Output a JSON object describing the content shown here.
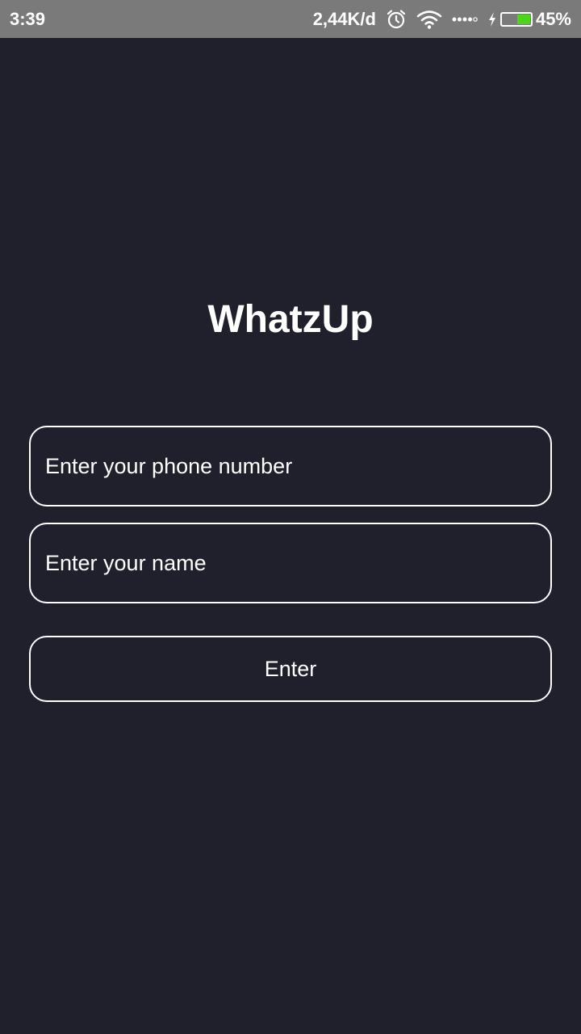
{
  "status_bar": {
    "time": "3:39",
    "net_speed": "2,44K/d",
    "battery_percent": "45%",
    "battery_level": 0.45,
    "icons": [
      "alarm-icon",
      "wifi-icon",
      "signal-icon",
      "charging-icon",
      "battery-icon"
    ],
    "battery_color": "#4cd419"
  },
  "app": {
    "title": "WhatzUp"
  },
  "form": {
    "phone_placeholder": "Enter your phone number",
    "phone_value": "",
    "name_placeholder": "Enter your name",
    "name_value": "",
    "submit_label": "Enter"
  },
  "colors": {
    "background": "#20202d",
    "status_bar": "#7a7a7a",
    "foreground": "#ffffff"
  }
}
